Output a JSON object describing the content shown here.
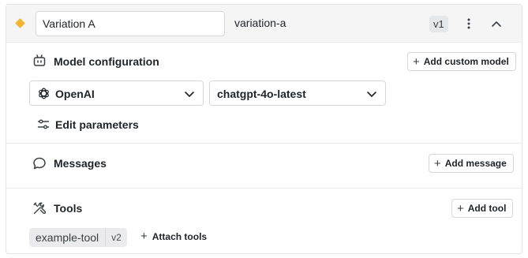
{
  "variation": {
    "name_value": "Variation A",
    "slug": "variation-a",
    "version": "v1",
    "accent_color": "#f2b533"
  },
  "model_config": {
    "title": "Model configuration",
    "add_custom_model_label": "Add custom model",
    "provider": "OpenAI",
    "model": "chatgpt-4o-latest",
    "edit_parameters_label": "Edit parameters"
  },
  "messages": {
    "title": "Messages",
    "add_message_label": "Add message"
  },
  "tools": {
    "title": "Tools",
    "add_tool_label": "Add tool",
    "items": [
      {
        "name": "example-tool",
        "version": "v2"
      }
    ],
    "attach_tools_label": "Attach tools"
  },
  "icons": {
    "status": "diamond-icon",
    "more": "kebab-icon",
    "collapse": "chevron-up-icon",
    "model": "robot-icon",
    "provider": "openai-logo-icon",
    "dropdown": "chevron-down-icon",
    "params": "sliders-icon",
    "messages": "chat-bubble-icon",
    "tools": "tools-icon",
    "add": "plus-icon"
  }
}
